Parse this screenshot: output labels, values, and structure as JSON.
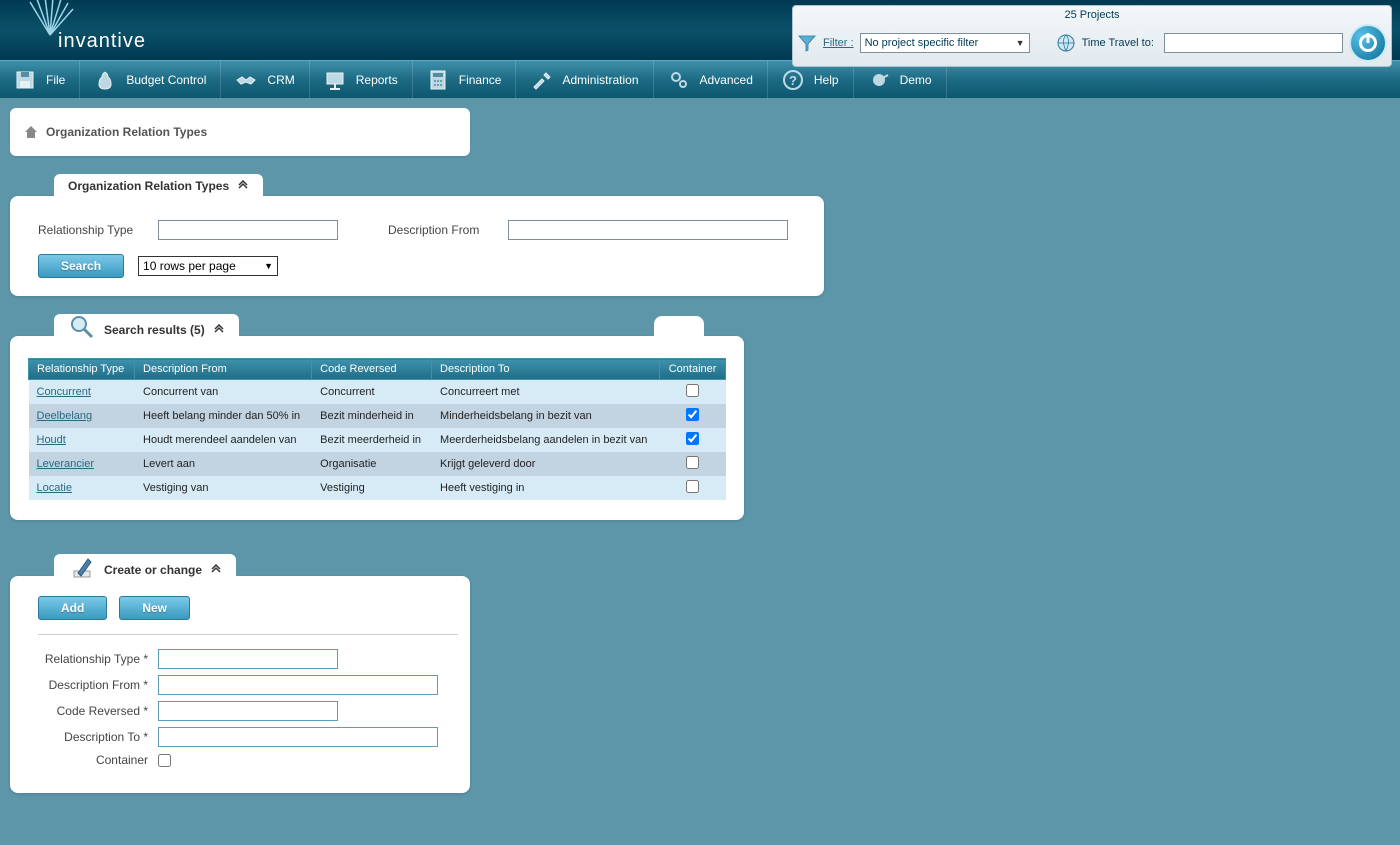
{
  "topbar": {
    "projects_label": "25 Projects",
    "filter_label": "Filter :",
    "filter_value": "No project specific filter",
    "time_label": "Time Travel to:",
    "time_value": ""
  },
  "logo_text": "invantive",
  "nav": [
    {
      "label": "File"
    },
    {
      "label": "Budget Control"
    },
    {
      "label": "CRM"
    },
    {
      "label": "Reports"
    },
    {
      "label": "Finance"
    },
    {
      "label": "Administration"
    },
    {
      "label": "Advanced"
    },
    {
      "label": "Help"
    },
    {
      "label": "Demo"
    }
  ],
  "breadcrumb": "Organization Relation Types",
  "search_panel": {
    "title": "Organization Relation Types",
    "relationship_type_label": "Relationship Type",
    "description_from_label": "Description From",
    "search_button": "Search",
    "rows_select": "10 rows per page"
  },
  "results_panel": {
    "title": "Search results (5)",
    "columns": [
      "Relationship Type",
      "Description From",
      "Code Reversed",
      "Description To",
      "Container"
    ],
    "rows": [
      {
        "type": "Concurrent",
        "desc_from": "Concurrent van",
        "code_rev": "Concurrent",
        "desc_to": "Concurreert met",
        "container": false
      },
      {
        "type": "Deelbelang",
        "desc_from": "Heeft belang minder dan 50% in",
        "code_rev": "Bezit minderheid in",
        "desc_to": "Minderheidsbelang in bezit van",
        "container": true
      },
      {
        "type": "Houdt",
        "desc_from": "Houdt merendeel aandelen van",
        "code_rev": "Bezit meerderheid in",
        "desc_to": "Meerderheidsbelang aandelen in bezit van",
        "container": true
      },
      {
        "type": "Leverancier",
        "desc_from": "Levert aan",
        "code_rev": "Organisatie",
        "desc_to": "Krijgt geleverd door",
        "container": false
      },
      {
        "type": "Locatie",
        "desc_from": "Vestiging van",
        "code_rev": "Vestiging",
        "desc_to": "Heeft vestiging in",
        "container": false
      }
    ]
  },
  "create_panel": {
    "title": "Create or change",
    "add_button": "Add",
    "new_button": "New",
    "fields": {
      "relationship_type": "Relationship Type *",
      "description_from": "Description From *",
      "code_reversed": "Code Reversed *",
      "description_to": "Description To *",
      "container": "Container"
    }
  }
}
